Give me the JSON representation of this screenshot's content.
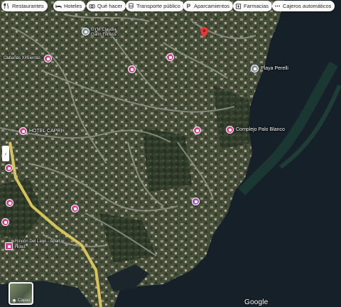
{
  "filters": [
    {
      "label": "Restaurantes",
      "icon": "fork-knife-icon"
    },
    {
      "label": "Hoteles",
      "icon": "bed-icon"
    },
    {
      "label": "Qué hacer",
      "icon": "camera-icon"
    },
    {
      "label": "Transporte público",
      "icon": "bus-icon"
    },
    {
      "label": "Aparcamientos",
      "icon": "parking-icon"
    },
    {
      "label": "Farmacias",
      "icon": "pharmacy-icon"
    },
    {
      "label": "Cajeros automáticos",
      "icon": "atm-icon"
    }
  ],
  "places": {
    "gym": "GYM Claudia\nGarin Fitness",
    "cabanas": "Cabañas Xl Sierras",
    "playa": "Playa Perelli",
    "hotel": "HOTEL CAPRI",
    "complejo": "Complejo Palo Blanco",
    "rincon": "Rincón Del Lago - Apart",
    "rincon_sub": "Hotel"
  },
  "map_controls": {
    "layers_label": "Capas",
    "attribution": "Google"
  },
  "colors": {
    "water": "#152029",
    "land": "#3b4532",
    "pin_pink": "#d63f8c",
    "road": "#8f9487",
    "highway": "#d6c35a"
  }
}
